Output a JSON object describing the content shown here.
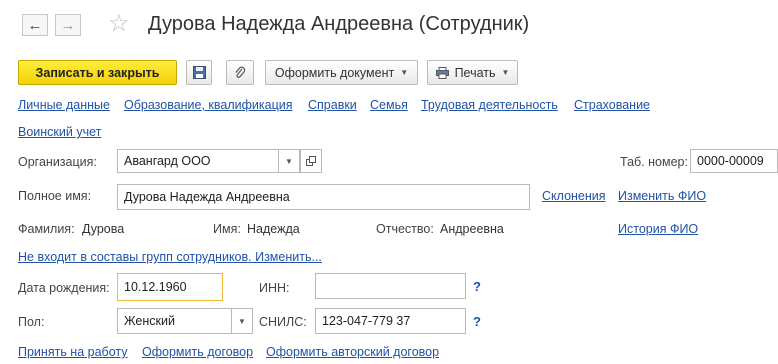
{
  "header": {
    "back_icon": "arrow-left-icon",
    "forward_icon": "arrow-right-icon",
    "favorite_icon": "star-icon",
    "title": "Дурова Надежда Андреевна (Сотрудник)"
  },
  "toolbar": {
    "save_close_label": "Записать и закрыть",
    "save_icon": "floppy-disk-icon",
    "attach_icon": "paperclip-icon",
    "document_label": "Оформить документ",
    "print_label": "Печать",
    "print_icon": "printer-icon"
  },
  "nav_links": [
    "Личные данные",
    "Образование, квалификация",
    "Справки",
    "Семья",
    "Трудовая деятельность",
    "Страхование",
    "Воинский учет"
  ],
  "form": {
    "org_label": "Организация:",
    "org_value": "Авангард ООО",
    "tab_label": "Таб. номер:",
    "tab_value": "0000-00009",
    "fullname_label": "Полное имя:",
    "fullname_value": "Дурова Надежда Андреевна",
    "declension_link": "Склонения",
    "change_fio_link": "Изменить ФИО",
    "surname_label": "Фамилия:",
    "surname_value": "Дурова",
    "name_label": "Имя:",
    "name_value": "Надежда",
    "patronymic_label": "Отчество:",
    "patronymic_value": "Андреевна",
    "history_fio_link": "История ФИО",
    "groups_link": "Не входит в составы групп сотрудников. Изменить...",
    "birth_label": "Дата рождения:",
    "birth_value": "10.12.1960",
    "inn_label": "ИНН:",
    "inn_value": "",
    "help_mark": "?",
    "gender_label": "Пол:",
    "gender_value": "Женский",
    "snils_label": "СНИЛС:",
    "snils_value": "123-047-779 37"
  },
  "footer_links": [
    "Принять на работу",
    "Оформить договор",
    "Оформить авторский договор"
  ],
  "colors": {
    "accent_yellow": "#f4d20a",
    "link_blue": "#2052a6",
    "focus_border": "#f0b93b"
  }
}
